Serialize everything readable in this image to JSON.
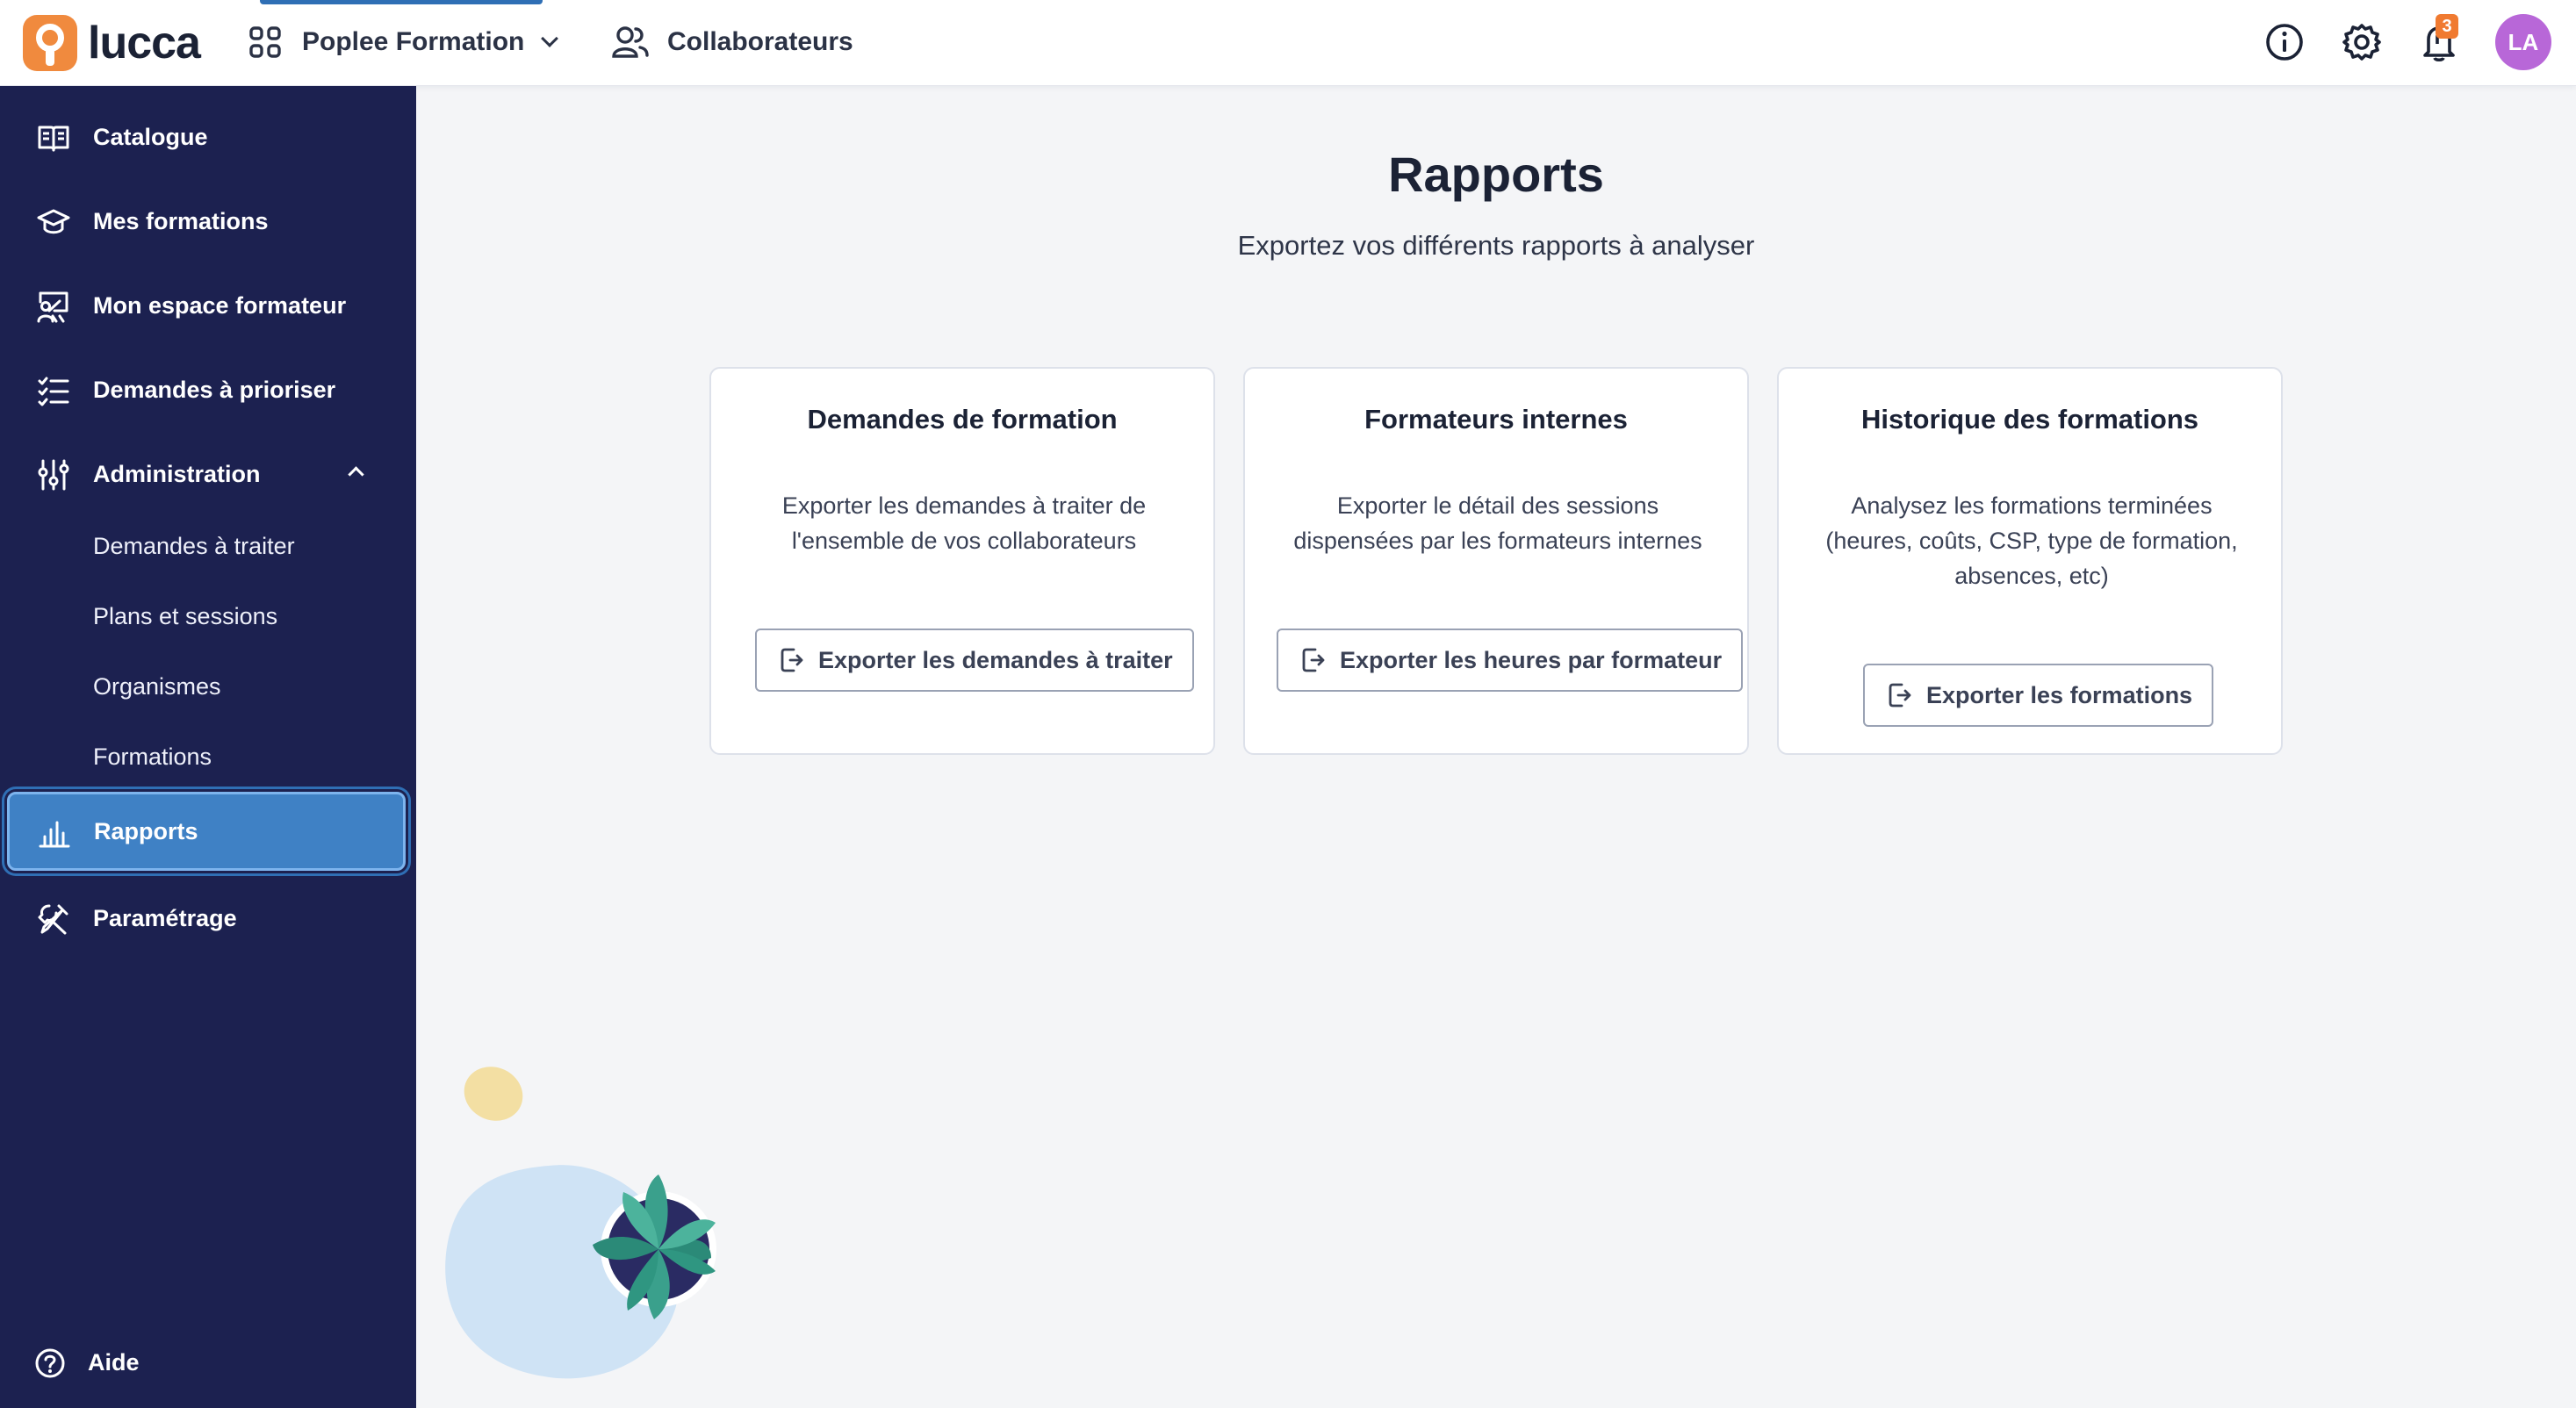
{
  "header": {
    "logo_text": "lucca",
    "app_switch_label": "Poplee Formation",
    "collaborators_label": "Collaborateurs",
    "notification_count": "3",
    "avatar_initials": "LA",
    "icons": [
      "apps-grid-icon",
      "chevron-down-icon",
      "users-icon",
      "info-icon",
      "gear-icon",
      "bell-icon"
    ]
  },
  "sidebar": {
    "items": [
      {
        "label": "Catalogue",
        "icon": "book-open-icon"
      },
      {
        "label": "Mes formations",
        "icon": "graduation-cap-icon"
      },
      {
        "label": "Mon espace formateur",
        "icon": "presentation-icon"
      },
      {
        "label": "Demandes à prioriser",
        "icon": "checklist-icon"
      },
      {
        "label": "Administration",
        "icon": "sliders-icon",
        "expanded": true
      },
      {
        "label": "Demandes à traiter"
      },
      {
        "label": "Plans et sessions"
      },
      {
        "label": "Organismes"
      },
      {
        "label": "Formations"
      },
      {
        "label": "Rapports",
        "icon": "bar-chart-icon",
        "active": true
      },
      {
        "label": "Paramétrage",
        "icon": "tools-icon"
      }
    ],
    "help_label": "Aide"
  },
  "main": {
    "title": "Rapports",
    "subtitle": "Exportez vos différents rapports à analyser",
    "cards": [
      {
        "title": "Demandes de formation",
        "description": "Exporter les demandes à traiter de l'ensemble de vos collaborateurs",
        "button_label": "Exporter les demandes à traiter"
      },
      {
        "title": "Formateurs internes",
        "description": "Exporter le détail des sessions dispensées par les formateurs internes",
        "button_label": "Exporter les heures par formateur"
      },
      {
        "title": "Historique des formations",
        "description": "Analysez les formations terminées (heures, coûts, CSP, type de formation, absences, etc)",
        "button_label": "Exporter les formations"
      }
    ]
  },
  "colors": {
    "sidebar_bg": "#1c2150",
    "active_item": "#3f81c5",
    "brand_orange": "#f08a3e",
    "avatar": "#b867d8",
    "page_bg": "#f4f5f7"
  }
}
